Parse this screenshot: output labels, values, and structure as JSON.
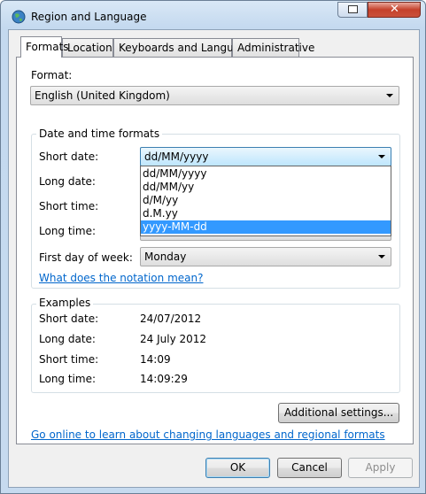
{
  "window": {
    "title": "Region and Language"
  },
  "tabs": [
    "Formats",
    "Location",
    "Keyboards and Languages",
    "Administrative"
  ],
  "format": {
    "label": "Format:",
    "value": "English (United Kingdom)"
  },
  "date_time": {
    "group_title": "Date and time formats",
    "short_date_label": "Short date:",
    "short_date_value": "dd/MM/yyyy",
    "long_date_label": "Long date:",
    "short_time_label": "Short time:",
    "long_time_label": "Long time:",
    "first_day_label": "First day of week:",
    "first_day_value": "Monday",
    "notation_link": "What does the notation mean?",
    "short_date_options": [
      "dd/MM/yyyy",
      "dd/MM/yy",
      "d/M/yy",
      "d.M.yy",
      "yyyy-MM-dd"
    ],
    "selected_option_index": 4
  },
  "examples": {
    "group_title": "Examples",
    "short_date_label": "Short date:",
    "short_date_value": "24/07/2012",
    "long_date_label": "Long date:",
    "long_date_value": "24 July 2012",
    "short_time_label": "Short time:",
    "short_time_value": "14:09",
    "long_time_label": "Long time:",
    "long_time_value": "14:09:29"
  },
  "additional_settings_label": "Additional settings...",
  "online_link": "Go online to learn about changing languages and regional formats",
  "buttons": {
    "ok": "OK",
    "cancel": "Cancel",
    "apply": "Apply"
  },
  "colors": {
    "selection": "#3399ff",
    "link": "#0066cc",
    "close_button": "#c5412b"
  }
}
